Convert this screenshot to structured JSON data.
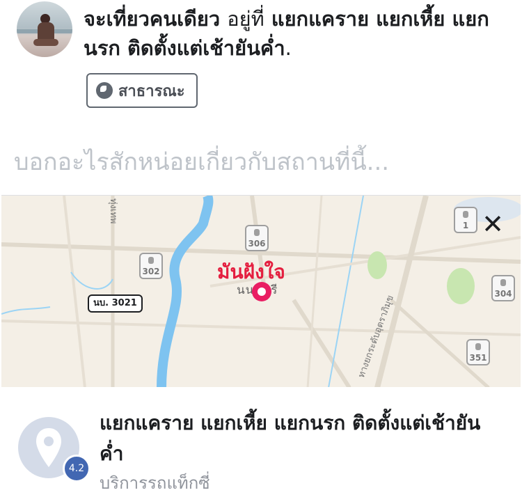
{
  "post": {
    "headline_bold": "จะเที่ยวคนเดียว",
    "headline_plain": "อยู่ที่",
    "headline_place": "แยกแคราย แยกเหี้ย แยกนรก ติดตั้งแต่เช้ายันค่ำ",
    "headline_end": ".",
    "audience_label": "สาธารณะ",
    "prompt_placeholder": "บอกอะไรสักหน่อยเกี่ยวกับสถานที่นี้..."
  },
  "map": {
    "pin_label": "มันฝังใจ",
    "town_label": "นนทบุรี",
    "road_tag": "นบ. 3021",
    "shields": [
      "306",
      "302",
      "1",
      "304",
      "351"
    ],
    "vertical_labels": [
      "ทุ่งเทพ",
      "ทางยกระดับอุตราภิมุข"
    ],
    "close_symbol": "✕"
  },
  "place": {
    "name": "แยกแคราย แยกเหี้ย แยกนรก ติดตั้งแต่เช้ายันค่ำ",
    "rating": "4.2",
    "category": "บริการรถแท็กซี่"
  },
  "colors": {
    "pin": "#e91e63",
    "pin_label": "#e41e3f",
    "rating_badge": "#4267b2",
    "river": "#7ec3f0",
    "map_bg": "#f4efe6"
  }
}
